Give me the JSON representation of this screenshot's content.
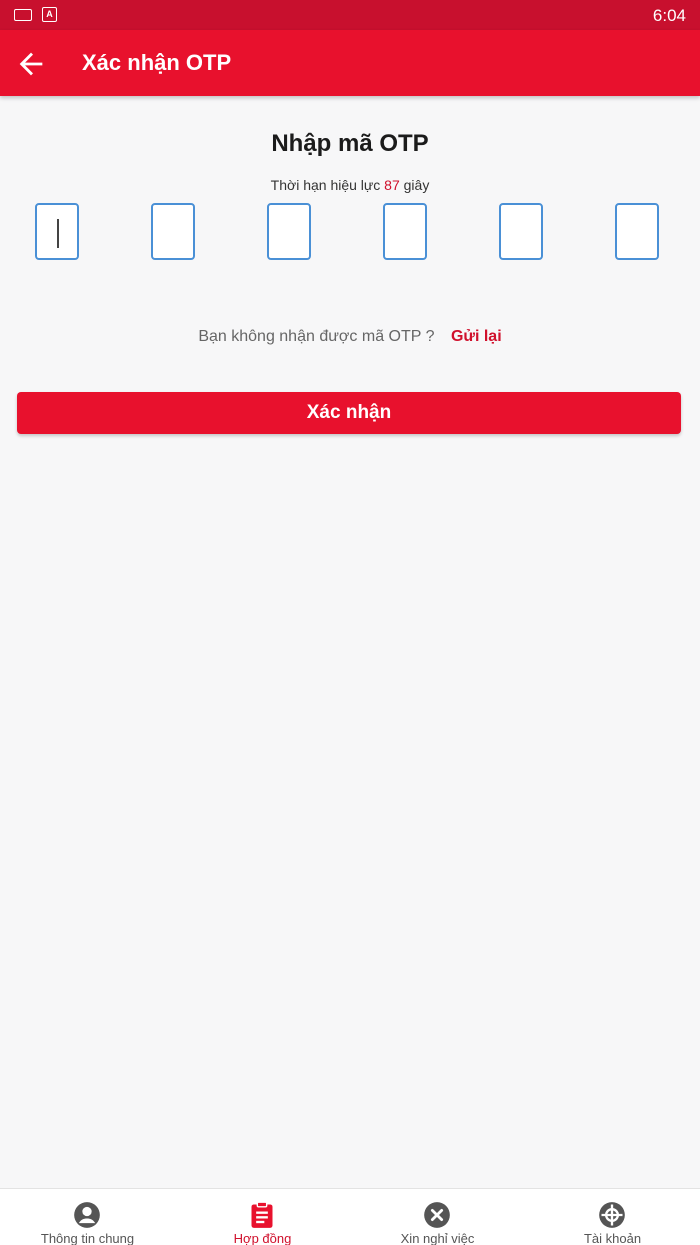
{
  "status_bar": {
    "time": "6:04"
  },
  "app_bar": {
    "title": "Xác nhận OTP"
  },
  "otp": {
    "heading": "Nhập mã OTP",
    "validity_prefix": "Thời hạn hiệu lực",
    "validity_seconds": "87",
    "validity_suffix": "giây",
    "digits": [
      "",
      "",
      "",
      "",
      "",
      ""
    ]
  },
  "resend": {
    "question": "Bạn không nhận được mã OTP ?",
    "link": "Gửi lại"
  },
  "confirm_button": {
    "label": "Xác nhận"
  },
  "bottom_nav": {
    "items": [
      {
        "label": "Thông tin chung",
        "icon": "user-circle-icon",
        "active": false
      },
      {
        "label": "Hợp đồng",
        "icon": "clipboard-icon",
        "active": true
      },
      {
        "label": "Xin nghỉ việc",
        "icon": "close-circle-icon",
        "active": false
      },
      {
        "label": "Tài khoản",
        "icon": "account-icon",
        "active": false
      }
    ]
  },
  "colors": {
    "primary": "#e8112d",
    "status_bar": "#c8102e",
    "otp_border": "#4a90d6",
    "accent_text": "#d0102c"
  }
}
